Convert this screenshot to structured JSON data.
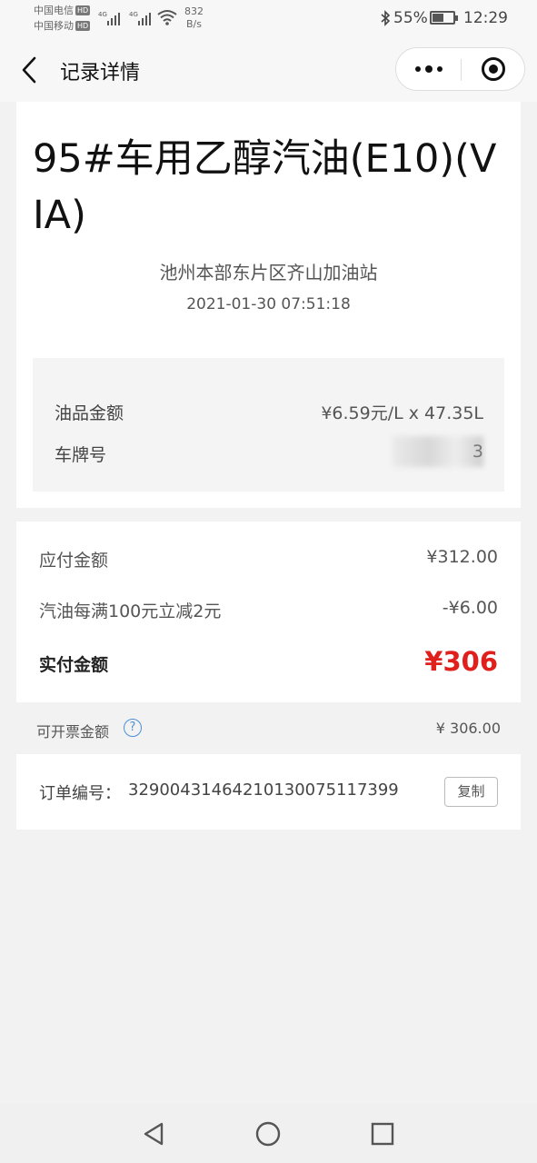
{
  "status_bar": {
    "carrier1": "中国电信",
    "carrier2": "中国移动",
    "hd": "HD",
    "signal_label": "4G",
    "net_speed_value": "832",
    "net_speed_unit": "B/s",
    "bluetooth_icon": "bluetooth-icon",
    "battery_percent": "55%",
    "battery_level": 0.55,
    "time": "12:29"
  },
  "nav": {
    "title": "记录详情",
    "back_icon": "chevron-left-icon",
    "more_icon": "more-dots-icon",
    "close_icon": "target-close-icon"
  },
  "record": {
    "product_name": "95#车用乙醇汽油(E10)(VIA)",
    "station": "池州本部东片区齐山加油站",
    "datetime": "2021-01-30 07:51:18",
    "fuel_amount_label": "油品金额",
    "fuel_amount_value": "¥6.59元/L x 47.35L",
    "plate_label": "车牌号",
    "plate_tail": "3"
  },
  "payment": {
    "payable_label": "应付金额",
    "payable_value": "¥312.00",
    "discount_label": "汽油每满100元立减2元",
    "discount_value": "-¥6.00",
    "paid_label": "实付金额",
    "paid_value": "¥306"
  },
  "invoice": {
    "label": "可开票金额",
    "help_icon": "question-circle-icon",
    "help_glyph": "?",
    "value": "¥ 306.00"
  },
  "order": {
    "label": "订单编号：",
    "number": "32900431464210130075117399",
    "copy_label": "复制"
  },
  "system_nav": {
    "back_icon": "triangle-back-icon",
    "home_icon": "circle-home-icon",
    "recent_icon": "square-recent-icon"
  },
  "colors": {
    "page_bg": "#f2f2f2",
    "card_bg": "#ffffff",
    "accent_red": "#e0201c",
    "help_blue": "#4a90d9"
  }
}
